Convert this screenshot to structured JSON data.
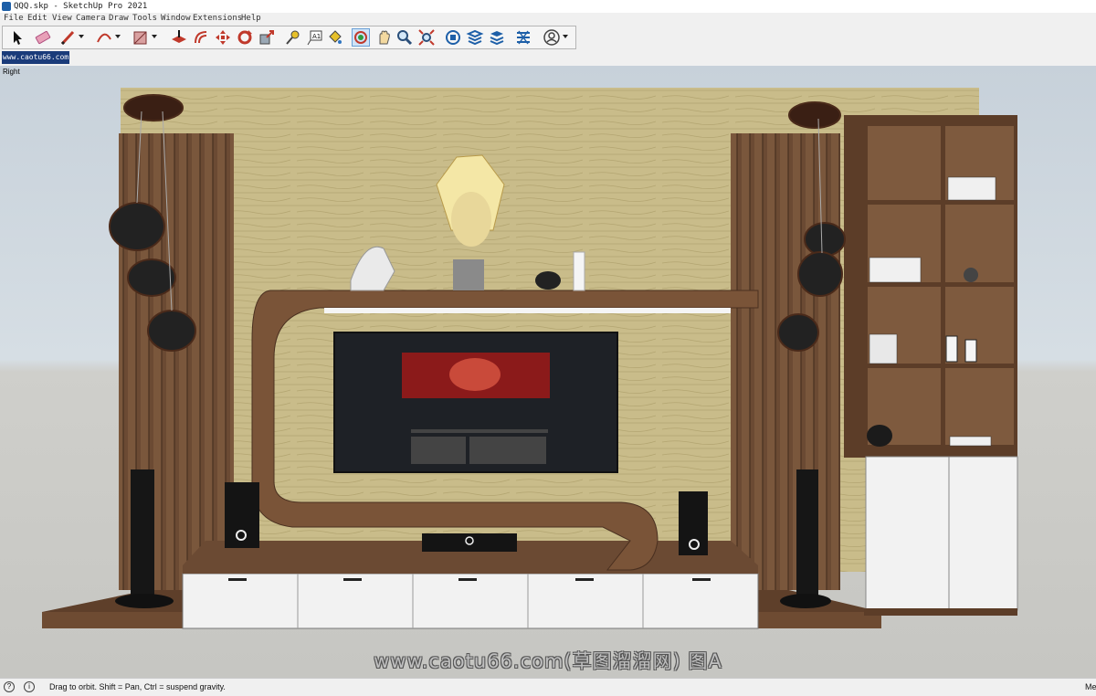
{
  "window": {
    "title": "QQQ.skp - SketchUp Pro 2021"
  },
  "menu": [
    "File",
    "Edit",
    "View",
    "Camera",
    "Draw",
    "Tools",
    "Window",
    "Extensions",
    "Help"
  ],
  "toolbar": {
    "tools": [
      {
        "name": "select-tool-icon"
      },
      {
        "name": "eraser-tool-icon"
      },
      {
        "name": "pencil-line-tool-icon"
      },
      {
        "name": "arc-tool-icon"
      },
      {
        "name": "rectangle-tool-icon"
      },
      {
        "name": "push-pull-tool-icon"
      },
      {
        "name": "offset-tool-icon"
      },
      {
        "name": "move-tool-icon"
      },
      {
        "name": "rotate-tool-icon"
      },
      {
        "name": "scale-tool-icon"
      },
      {
        "name": "tape-measure-tool-icon"
      },
      {
        "name": "text-tool-icon"
      },
      {
        "name": "paint-bucket-tool-icon"
      },
      {
        "name": "orbit-tool-icon"
      },
      {
        "name": "pan-tool-icon"
      },
      {
        "name": "zoom-tool-icon"
      },
      {
        "name": "zoom-extents-tool-icon"
      },
      {
        "name": "3d-warehouse-icon"
      },
      {
        "name": "extension-warehouse-icon"
      },
      {
        "name": "layout-icon"
      },
      {
        "name": "extension-manager-icon"
      },
      {
        "name": "account-icon"
      }
    ],
    "active_tool": "orbit-tool-icon"
  },
  "scene_tab": {
    "label": "www.caotu66.com"
  },
  "viewport": {
    "view_label": "Right",
    "watermark": "www.caotu66.com(草图溜溜网) 图A",
    "colors": {
      "wood_dark": "#6b4a33",
      "wood_panel": "#c9bc8a",
      "cabinet_white": "#f2f2f2"
    }
  },
  "status": {
    "text": "Drag to orbit. Shift = Pan, Ctrl = suspend gravity.",
    "measurements_label": "Me"
  }
}
